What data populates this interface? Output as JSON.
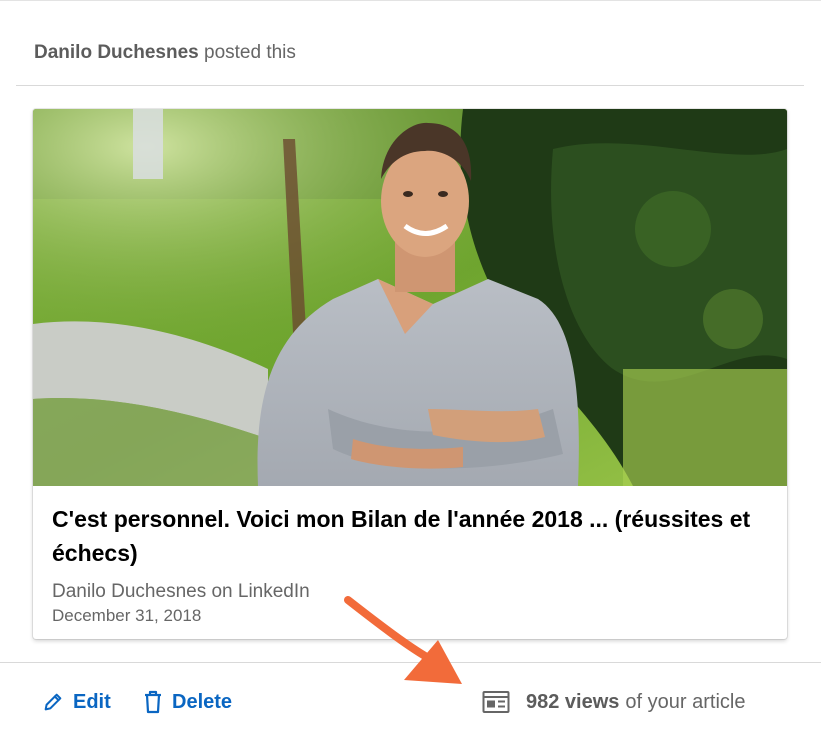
{
  "post": {
    "author": "Danilo Duchesnes",
    "action_text": "posted this"
  },
  "article": {
    "title": "C'est personnel. Voici mon Bilan de l'année 2018 ... (réussites et échecs)",
    "source": "Danilo Duchesnes on LinkedIn",
    "date": "December 31, 2018"
  },
  "footer": {
    "edit_label": "Edit",
    "delete_label": "Delete",
    "views_count": "982 views",
    "views_suffix": "of your article"
  },
  "colors": {
    "link_blue": "#0a66c2",
    "annotation_arrow": "#f26b3a",
    "muted_text": "#666666"
  },
  "icons": {
    "edit": "pencil-icon",
    "delete": "trash-icon",
    "views": "article-views-icon"
  }
}
